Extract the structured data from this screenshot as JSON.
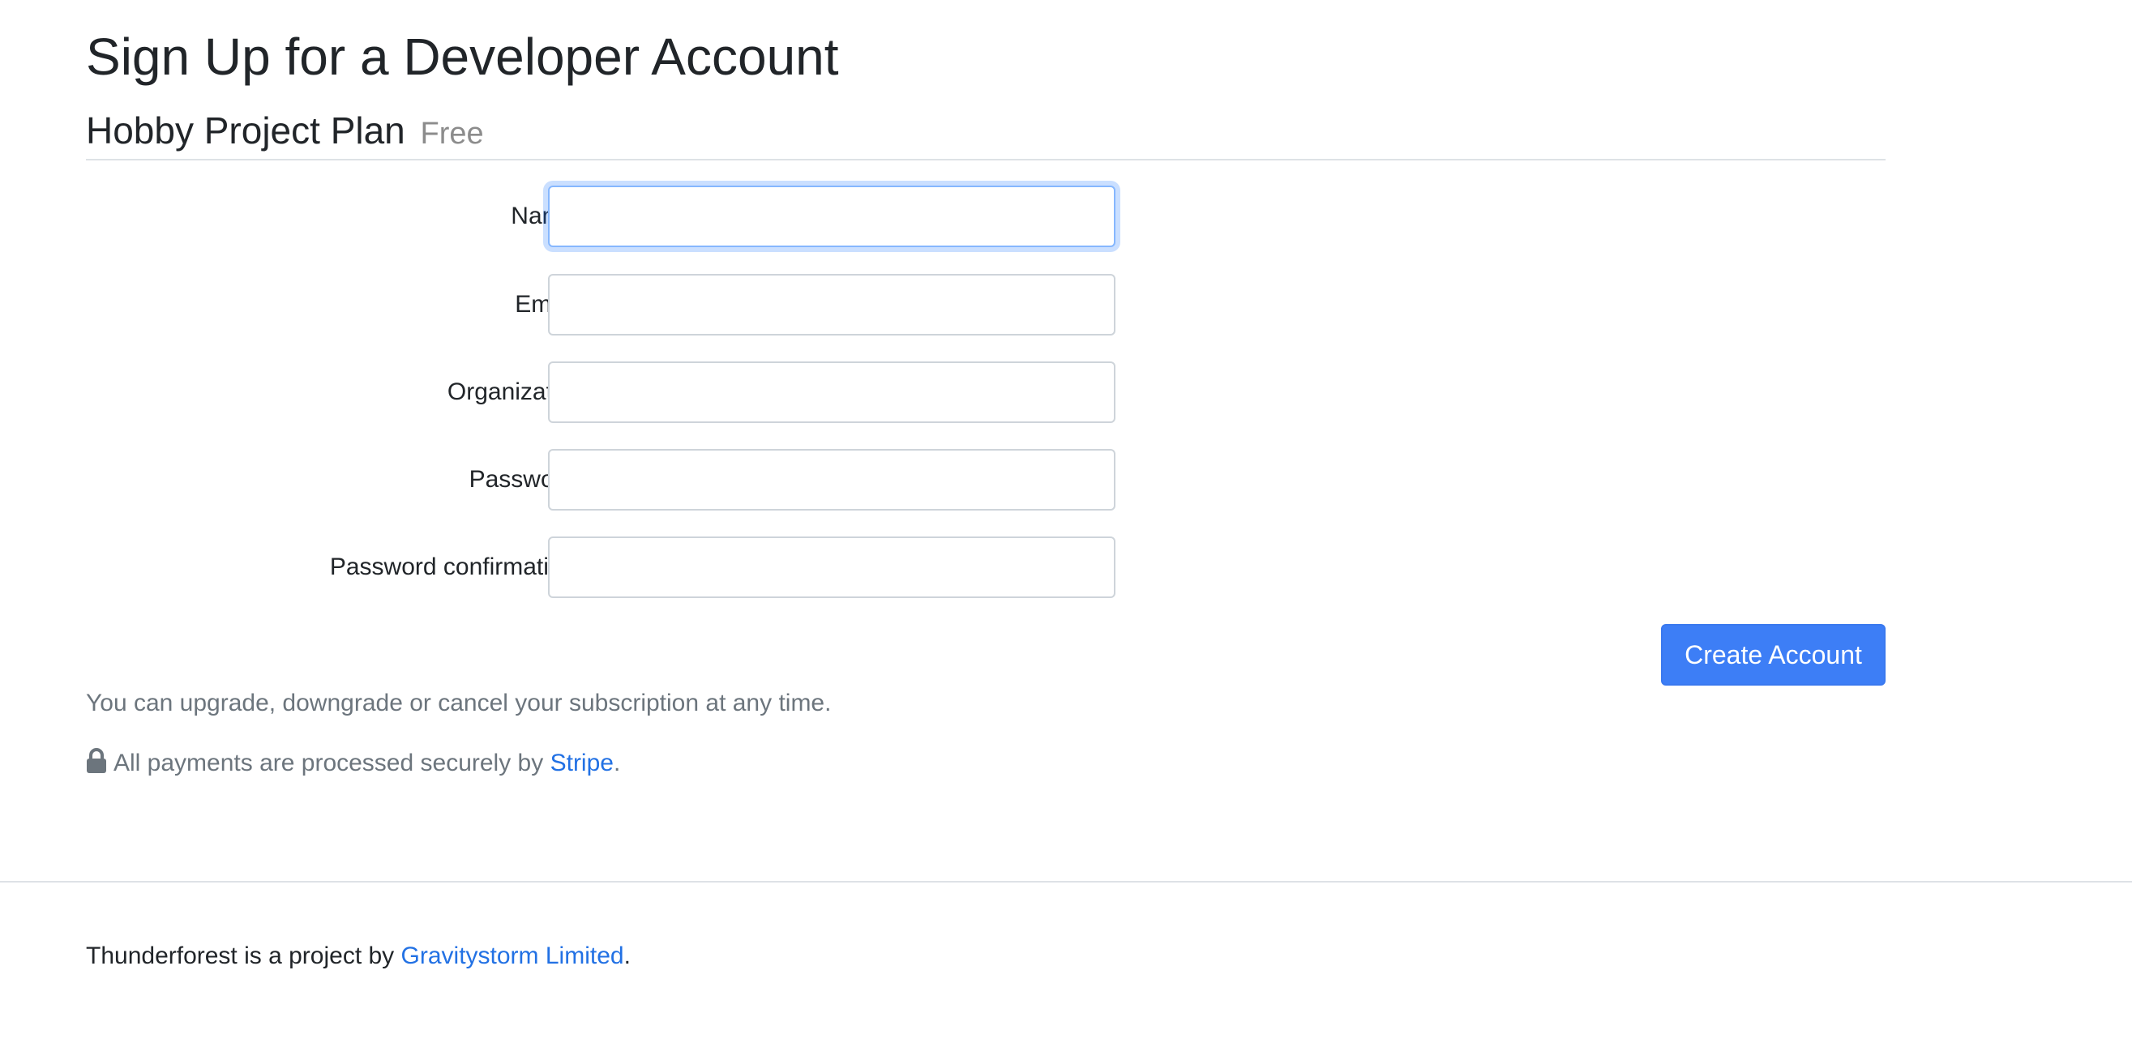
{
  "page": {
    "title": "Sign Up for a Developer Account"
  },
  "plan": {
    "name": "Hobby Project Plan",
    "price": "Free"
  },
  "form": {
    "fields": [
      {
        "label": "Name",
        "required_marker": "*",
        "value": "",
        "focused": true
      },
      {
        "label": "Email",
        "required_marker": "*",
        "value": ""
      },
      {
        "label": "Organization",
        "required_marker": "",
        "value": ""
      },
      {
        "label": "Password",
        "required_marker": "*",
        "value": ""
      },
      {
        "label": "Password confirmation",
        "required_marker": "*",
        "value": ""
      }
    ],
    "submit_label": "Create Account"
  },
  "notes": {
    "subscription": "You can upgrade, downgrade or cancel your subscription at any time.",
    "payments_prefix": "All payments are processed securely by",
    "payments_link": "Stripe",
    "payments_suffix": ".",
    "lock_icon": "lock-icon"
  },
  "footer": {
    "prefix": "Thunderforest is a project by",
    "link": "Gravitystorm Limited",
    "suffix": "."
  },
  "colors": {
    "primary_button": "#3d7ef6",
    "link": "#2271e4",
    "muted": "#6c757d",
    "focus_ring": "#86b7fe"
  }
}
